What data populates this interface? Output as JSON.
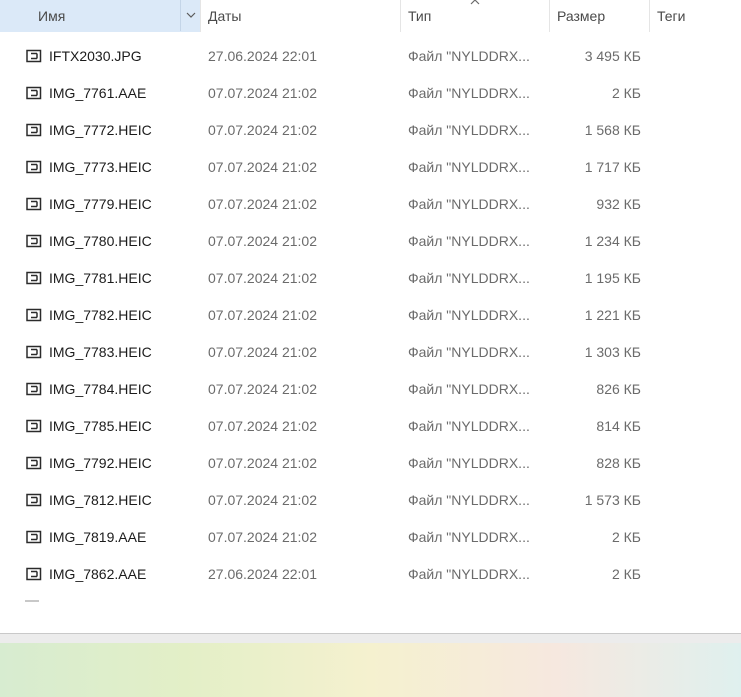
{
  "columns": {
    "name": "Имя",
    "date": "Даты",
    "type": "Тип",
    "size": "Размер",
    "tags": "Теги"
  },
  "files": [
    {
      "name": "IFTX2030.JPG",
      "date": "27.06.2024 22:01",
      "type": "Файл \"NYLDDRX...",
      "size": "3 495 КБ"
    },
    {
      "name": "IMG_7761.AAE",
      "date": "07.07.2024 21:02",
      "type": "Файл \"NYLDDRX...",
      "size": "2 КБ"
    },
    {
      "name": "IMG_7772.HEIC",
      "date": "07.07.2024 21:02",
      "type": "Файл \"NYLDDRX...",
      "size": "1 568 КБ"
    },
    {
      "name": "IMG_7773.HEIC",
      "date": "07.07.2024 21:02",
      "type": "Файл \"NYLDDRX...",
      "size": "1 717 КБ"
    },
    {
      "name": "IMG_7779.HEIC",
      "date": "07.07.2024 21:02",
      "type": "Файл \"NYLDDRX...",
      "size": "932 КБ"
    },
    {
      "name": "IMG_7780.HEIC",
      "date": "07.07.2024 21:02",
      "type": "Файл \"NYLDDRX...",
      "size": "1 234 КБ"
    },
    {
      "name": "IMG_7781.HEIC",
      "date": "07.07.2024 21:02",
      "type": "Файл \"NYLDDRX...",
      "size": "1 195 КБ"
    },
    {
      "name": "IMG_7782.HEIC",
      "date": "07.07.2024 21:02",
      "type": "Файл \"NYLDDRX...",
      "size": "1 221 КБ"
    },
    {
      "name": "IMG_7783.HEIC",
      "date": "07.07.2024 21:02",
      "type": "Файл \"NYLDDRX...",
      "size": "1 303 КБ"
    },
    {
      "name": "IMG_7784.HEIC",
      "date": "07.07.2024 21:02",
      "type": "Файл \"NYLDDRX...",
      "size": "826 КБ"
    },
    {
      "name": "IMG_7785.HEIC",
      "date": "07.07.2024 21:02",
      "type": "Файл \"NYLDDRX...",
      "size": "814 КБ"
    },
    {
      "name": "IMG_7792.HEIC",
      "date": "07.07.2024 21:02",
      "type": "Файл \"NYLDDRX...",
      "size": "828 КБ"
    },
    {
      "name": "IMG_7812.HEIC",
      "date": "07.07.2024 21:02",
      "type": "Файл \"NYLDDRX...",
      "size": "1 573 КБ"
    },
    {
      "name": "IMG_7819.AAE",
      "date": "07.07.2024 21:02",
      "type": "Файл \"NYLDDRX...",
      "size": "2 КБ"
    },
    {
      "name": "IMG_7862.AAE",
      "date": "27.06.2024 22:01",
      "type": "Файл \"NYLDDRX...",
      "size": "2 КБ"
    }
  ],
  "icons": {
    "file": "generic-file-icon",
    "sort": "sort-ascending-icon",
    "column_menu": "chevron-down-icon"
  },
  "colors": {
    "selected_header": "#dbe9f8",
    "secondary_text": "#6b6b6b",
    "primary_text": "#1b1b1b"
  }
}
